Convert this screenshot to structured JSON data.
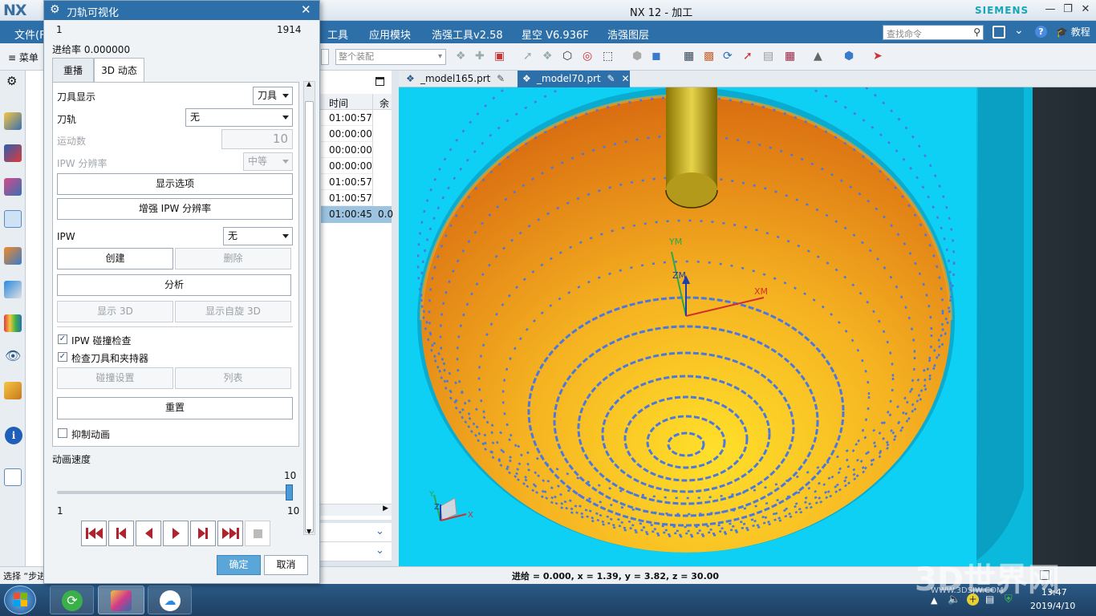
{
  "app": {
    "logo": "NX",
    "window_title": "NX 12 - 加工",
    "brand": "SIEMENS",
    "file_menu": "文件(F",
    "menus": [
      "工具",
      "应用模块",
      "浩强工具v2.58",
      "星空 V6.936F",
      "浩强图层"
    ],
    "search_placeholder": "查找命令",
    "tutorial": "教程",
    "menu_btn": "菜单",
    "assembly_select": "整个装配"
  },
  "file_tabs": [
    "_model165.prt",
    "_model70.prt"
  ],
  "nav": {
    "time_header": "时间",
    "rest_header": "余",
    "times": [
      "01:00:57",
      "00:00:00",
      "00:00:00",
      "00:00:00",
      "01:00:57",
      "01:00:57",
      "01:00:45"
    ],
    "selected_extra": "0.0"
  },
  "dialog": {
    "title": "刀轨可视化",
    "step": "1",
    "total": "1914",
    "feed_rate": "进给率 0.000000",
    "tabs": [
      "重播",
      "3D 动态"
    ],
    "tool_display_label": "刀具显示",
    "tool_display_value": "刀具",
    "toolpath_label": "刀轨",
    "toolpath_value": "无",
    "motion_count_label": "运动数",
    "motion_count_value": "10",
    "ipw_res_label": "IPW 分辨率",
    "ipw_res_value": "中等",
    "display_options": "显示选项",
    "enhance_ipw": "增强 IPW 分辨率",
    "ipw_label": "IPW",
    "ipw_value": "无",
    "create": "创建",
    "delete": "删除",
    "analyze": "分析",
    "show_3d": "显示 3D",
    "show_rotate_3d": "显示自旋 3D",
    "ipw_collision": "IPW 碰撞检查",
    "check_tool_holder": "检查刀具和夹持器",
    "collision_settings": "碰撞设置",
    "list": "列表",
    "reset": "重置",
    "suppress_anim": "抑制动画",
    "anim_speed": "动画速度",
    "speed_value": "10",
    "speed_fraction": 1.0,
    "speed_min": "1",
    "speed_max": "10",
    "ok": "确定",
    "cancel": "取消"
  },
  "viewport": {
    "axis_labels": [
      "YM",
      "ZM",
      "XM"
    ],
    "mini_axis": [
      "Y",
      "Z",
      "X"
    ]
  },
  "status": {
    "select_prompt": "选择 “步进",
    "coords": "进给 = 0.000, x = 1.39, y = 3.82, z = 30.00"
  },
  "taskbar": {
    "time": "13:47",
    "date": "2019/4/10",
    "watermark": "3D世界网",
    "watermark_url": "WWW.3DSJW.COM"
  },
  "colors": {
    "accent": "#2d6fa8",
    "part_orange": "#f5a623",
    "stock_cyan": "#00c8f0",
    "toolpath_blue": "#4a78e0"
  }
}
